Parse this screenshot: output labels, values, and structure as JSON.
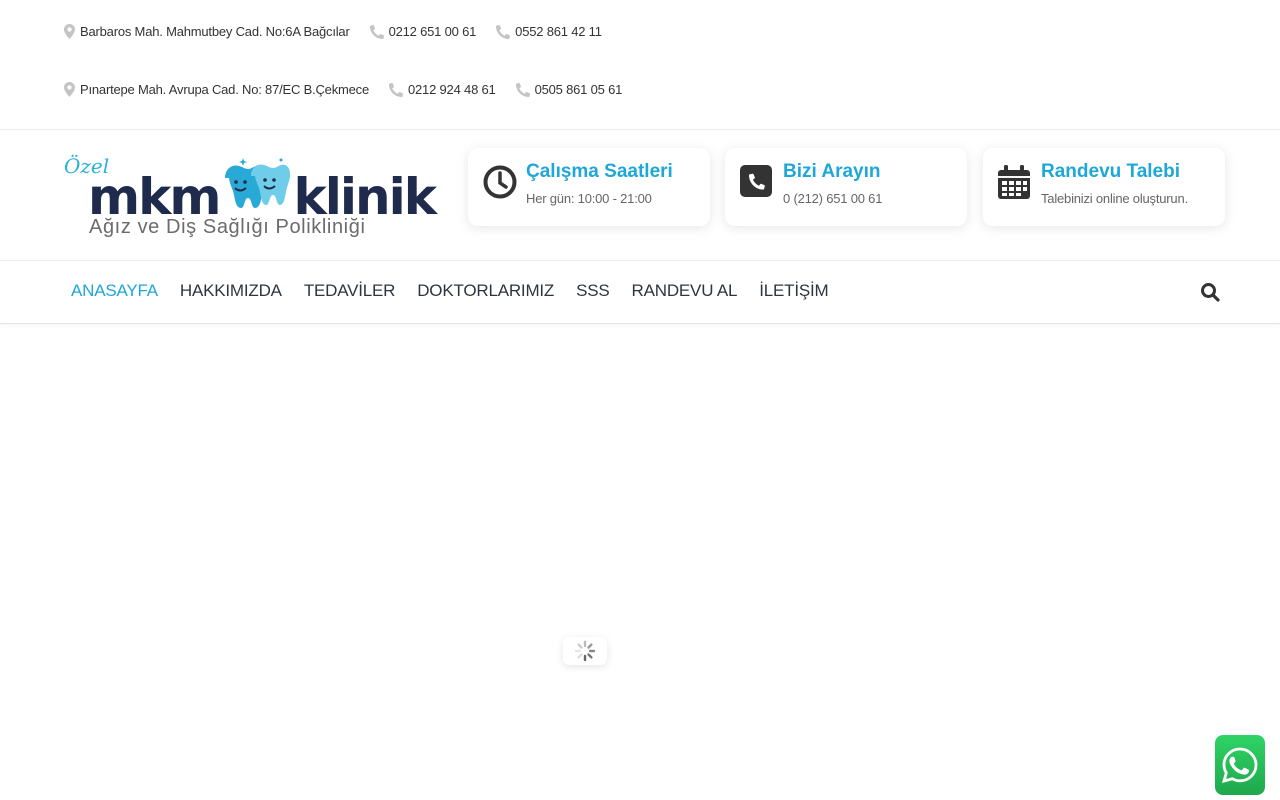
{
  "topbar": {
    "row1": {
      "address": "Barbaros Mah. Mahmutbey Cad. No:6A Bağcılar",
      "phone1": "0212 651 00 61",
      "phone2": "0552 861 42 11"
    },
    "row2": {
      "address": "Pınartepe Mah. Avrupa Cad. No: 87/EC B.Çekmece",
      "phone1": "0212 924 48 61",
      "phone2": "0505 861 05 61"
    },
    "icons": {
      "address": "map-marker-icon",
      "phone": "phone-icon"
    }
  },
  "logo": {
    "prefix": "Özel",
    "left": "mkm",
    "right": "klinik",
    "subtitle": "Ağız ve Diş Sağlığı Polikliniği"
  },
  "info_boxes": [
    {
      "icon": "clock-icon",
      "title": "Çalışma Saatleri",
      "subtitle": "Her gün: 10:00 - 21:00"
    },
    {
      "icon": "phone-square-icon",
      "title": "Bizi Arayın",
      "subtitle": "0 (212) 651 00 61"
    },
    {
      "icon": "calendar-icon",
      "title": "Randevu Talebi",
      "subtitle": "Talebinizi online oluşturun."
    }
  ],
  "nav": {
    "items": [
      "ANASAYFA",
      "HAKKIMIZDA",
      "TEDAVİLER",
      "DOKTORLARIMIZ",
      "SSS",
      "RANDEVU AL",
      "İLETİŞİM"
    ],
    "active_index": 0,
    "search_icon": "search-icon"
  },
  "colors": {
    "accent": "#1fa7d8",
    "text_dark": "#2f3540",
    "icon_gray": "#c4c4c4",
    "whatsapp_green": "#25d366"
  },
  "loader_icon": "spinner-icon",
  "whatsapp_icon": "whatsapp-icon"
}
